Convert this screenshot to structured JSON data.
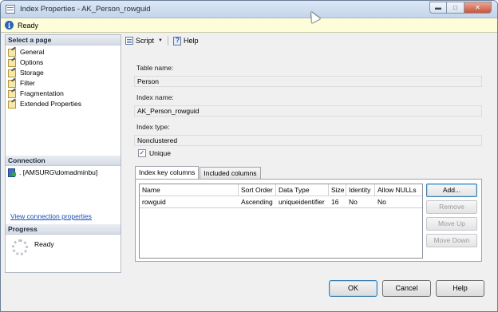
{
  "window": {
    "title": "Index Properties - AK_Person_rowguid",
    "controls": [
      "minimize-icon",
      "maximize-icon",
      "close-icon"
    ]
  },
  "status_bar": {
    "icon": "info-icon",
    "text": "Ready"
  },
  "left_pane": {
    "select_page": {
      "header": "Select a page",
      "items": [
        {
          "label": "General",
          "icon": "page-icon"
        },
        {
          "label": "Options",
          "icon": "page-icon"
        },
        {
          "label": "Storage",
          "icon": "page-icon"
        },
        {
          "label": "Filter",
          "icon": "page-icon"
        },
        {
          "label": "Fragmentation",
          "icon": "page-icon"
        },
        {
          "label": "Extended Properties",
          "icon": "page-icon"
        }
      ]
    },
    "connection": {
      "header": "Connection",
      "server": ". [AMSURG\\domadminbu]",
      "link": "View connection properties"
    },
    "progress": {
      "header": "Progress",
      "status": "Ready"
    }
  },
  "toolbar": {
    "script_label": "Script",
    "help_label": "Help"
  },
  "form": {
    "table_name": {
      "label": "Table name:",
      "value": "Person"
    },
    "index_name": {
      "label": "Index name:",
      "value": "AK_Person_rowguid"
    },
    "index_type": {
      "label": "Index type:",
      "value": "Nonclustered"
    },
    "unique": {
      "label": "Unique",
      "checked": true,
      "mark": "✓"
    }
  },
  "tabs": {
    "active": "Index key columns",
    "other": "Included columns"
  },
  "key_columns": {
    "headers": [
      "Name",
      "Sort Order",
      "Data Type",
      "Size",
      "Identity",
      "Allow NULLs"
    ],
    "rows": [
      [
        "rowguid",
        "Ascending",
        "uniqueidentifier",
        "16",
        "No",
        "No"
      ]
    ]
  },
  "column_buttons": {
    "add": "Add...",
    "remove": "Remove",
    "move_up": "Move Up",
    "move_down": "Move Down"
  },
  "dialog_buttons": {
    "ok": "OK",
    "cancel": "Cancel",
    "help": "Help"
  }
}
